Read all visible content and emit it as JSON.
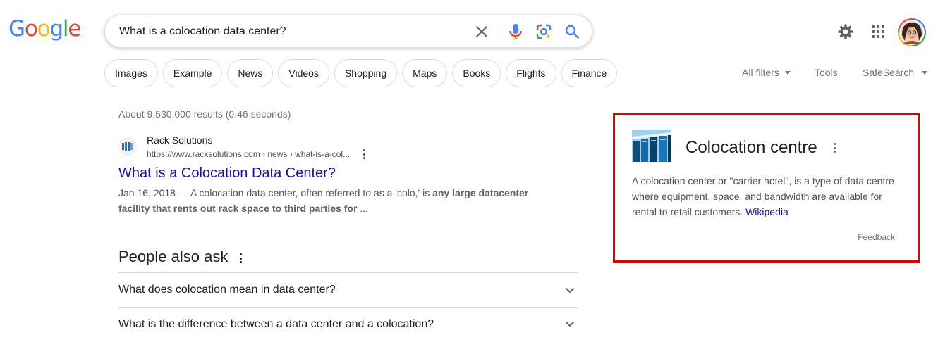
{
  "logo": {
    "letters": [
      "G",
      "o",
      "o",
      "g",
      "l",
      "e"
    ],
    "colors": [
      "#4285F4",
      "#EA4335",
      "#FBBC05",
      "#4285F4",
      "#34A853",
      "#EA4335"
    ]
  },
  "search": {
    "query": "What is a colocation data center?",
    "icons": [
      "close-icon",
      "microphone-icon",
      "lens-icon",
      "search-icon"
    ]
  },
  "header_icons": [
    "settings-gear-icon",
    "apps-grid-icon",
    "avatar"
  ],
  "chips": [
    {
      "label": "Images"
    },
    {
      "label": "Example"
    },
    {
      "label": "News"
    },
    {
      "label": "Videos"
    },
    {
      "label": "Shopping"
    },
    {
      "label": "Maps"
    },
    {
      "label": "Books"
    },
    {
      "label": "Flights"
    },
    {
      "label": "Finance"
    }
  ],
  "tools": {
    "all_filters": "All filters",
    "tools": "Tools",
    "safesearch": "SafeSearch"
  },
  "stats": "About 9,530,000 results (0.46 seconds)",
  "result": {
    "site_name": "Rack Solutions",
    "url": "https://www.racksolutions.com › news › what-is-a-col...",
    "title": "What is a Colocation Data Center?",
    "date": "Jan 16, 2018",
    "snippet_plain": " — A colocation data center, often referred to as a 'colo,' is ",
    "snippet_bold": "any large datacenter facility that rents out rack space to third parties for",
    "snippet_end": " ..."
  },
  "people_also_ask": {
    "title": "People also ask",
    "questions": [
      "What does colocation mean in data center?",
      "What is the difference between a data center and a colocation?"
    ]
  },
  "knowledge_panel": {
    "title": "Colocation centre",
    "description": "A colocation center or \"carrier hotel\", is a type of data centre where equipment, space, and bandwidth are available for rental to retail customers. ",
    "source": "Wikipedia",
    "feedback": "Feedback",
    "highlight_color": "#e00000"
  },
  "colors": {
    "link": "#1a0dab",
    "text": "#202124",
    "secondary": "#70757a"
  }
}
